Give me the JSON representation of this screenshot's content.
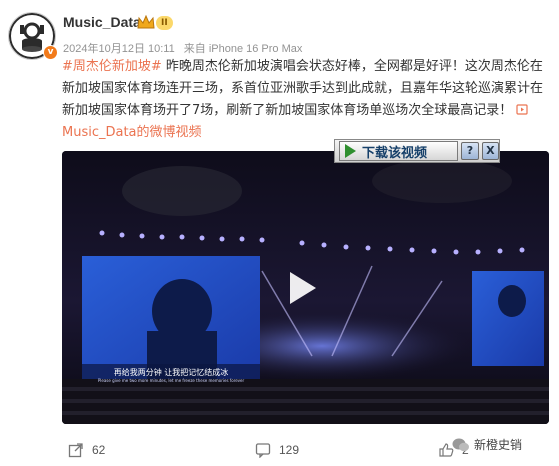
{
  "user": {
    "name": "Music_Data",
    "level_badge": "II",
    "verified_mark": "v"
  },
  "meta": {
    "date": "2024年10月12日 10:11",
    "source": "来自 iPhone 16 Pro Max"
  },
  "post": {
    "hashtag": "#周杰伦新加坡#",
    "text": " 昨晚周杰伦新加坡演唱会状态好棒，全网都是好评！这次周杰伦在新加坡国家体育场连开三场，系首位亚洲歌手达到此成就，且嘉年华这轮巡演累计在新加坡国家体育场开了7场，刷新了新加坡国家体育场单巡场次全球最高记录！ ",
    "video_link": "Music_Data的微博视频"
  },
  "download_bar": {
    "label": "下载该视频",
    "help": "?",
    "close": "X"
  },
  "video": {
    "subtitle_cn": "再给我两分钟 让我把记忆结成冰",
    "subtitle_en": "Please give me two more minutes, let me freeze these memories forever"
  },
  "actions": {
    "share_count": "62",
    "comment_count": "129",
    "like_count": "2"
  },
  "watermark": {
    "text": "新橙史销"
  },
  "colors": {
    "link": "#eb7350",
    "meta": "#939393",
    "badge_orange": "#f27a1a"
  }
}
